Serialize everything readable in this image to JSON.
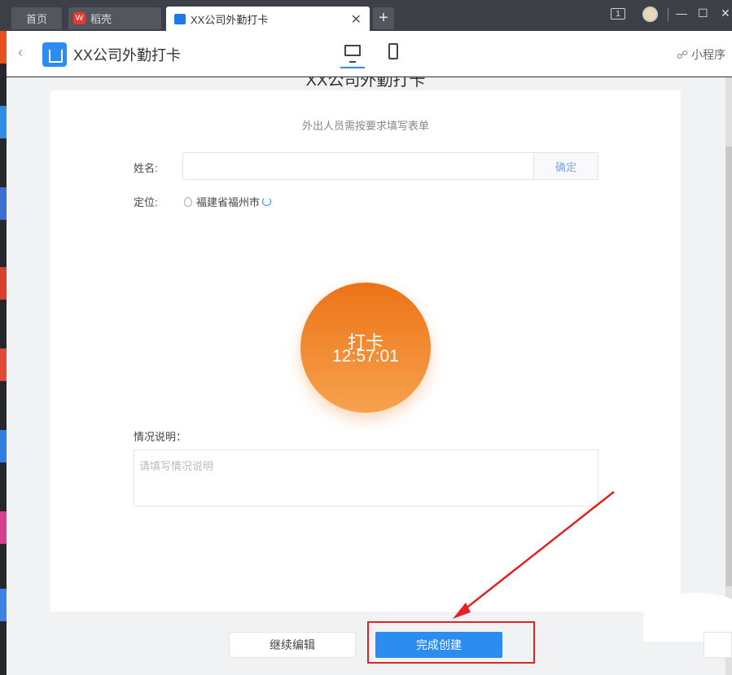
{
  "browser": {
    "tabs": [
      {
        "label": "首页"
      },
      {
        "label": "稻壳",
        "icon_text": "W"
      },
      {
        "label": "XX公司外勤打卡"
      }
    ],
    "window_count": "1",
    "new_tab": "+",
    "close_tab": "✕",
    "controls": {
      "minimize": "—",
      "maximize": "☐",
      "close": "✕"
    }
  },
  "header": {
    "back": "‹",
    "title": "XX公司外勤打卡",
    "mini_program": "小程序"
  },
  "form": {
    "title": "XX公司外勤打卡",
    "subtitle": "外出人员需按要求填写表单",
    "name_label": "姓名:",
    "name_value": "",
    "confirm": "确定",
    "location_label": "定位:",
    "location_value": "福建省福州市",
    "clock_label": "打卡",
    "clock_time": "12:57:01",
    "remark_label": "情况说明：",
    "remark_placeholder": "请填写情况说明"
  },
  "footer": {
    "continue_edit": "继续编辑",
    "finish_create": "完成创建"
  },
  "colors": {
    "accent": "#2d8cf0",
    "clock_top": "#ec7317",
    "clock_bottom": "#f7a24e",
    "annotation": "#e32222"
  },
  "icons": [
    "back-chevron-icon",
    "app-form-icon",
    "desktop-view-icon",
    "mobile-view-icon",
    "link-icon",
    "location-pin-icon",
    "refresh-icon",
    "close-icon"
  ]
}
